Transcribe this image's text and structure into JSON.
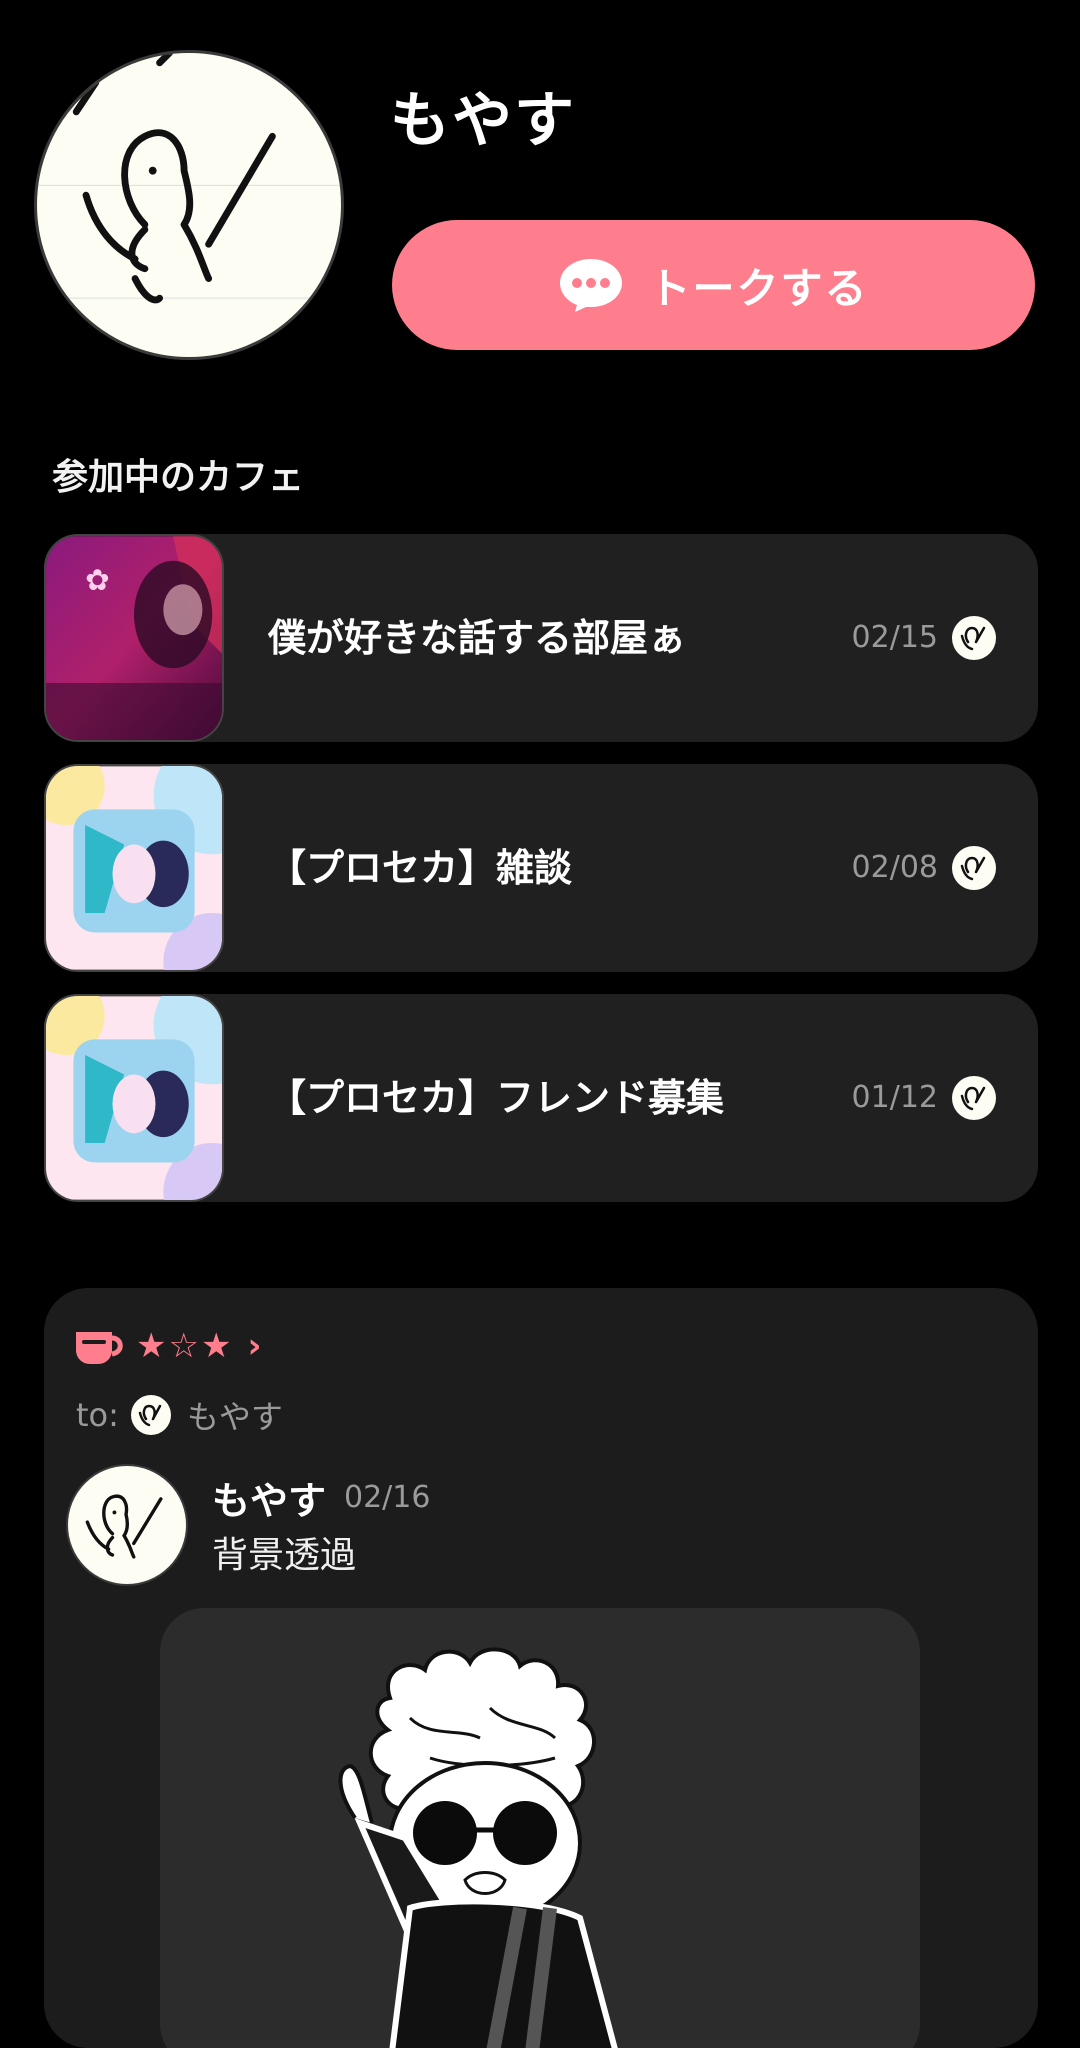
{
  "profile": {
    "name": "もやす",
    "avatar_icon": "doodle-avatar-icon",
    "talk_button_label": "トークする",
    "talk_icon": "chat-bubble-icon",
    "accent_color": "#fe7e8e"
  },
  "cafes": {
    "section_title": "参加中のカフェ",
    "items": [
      {
        "name": "僕が好きな話する部屋ぁ",
        "date": "02/15"
      },
      {
        "name": "【プロセカ】雑談",
        "date": "02/08"
      },
      {
        "name": "【プロセカ】フレンド募集",
        "date": "01/12"
      }
    ]
  },
  "post": {
    "cup_icon": "coffee-cup-icon",
    "stars": "★☆★",
    "chevron": "›",
    "to_label": "to:",
    "to_name": "もやす",
    "author": "もやす",
    "date": "02/16",
    "text": "背景透過"
  }
}
